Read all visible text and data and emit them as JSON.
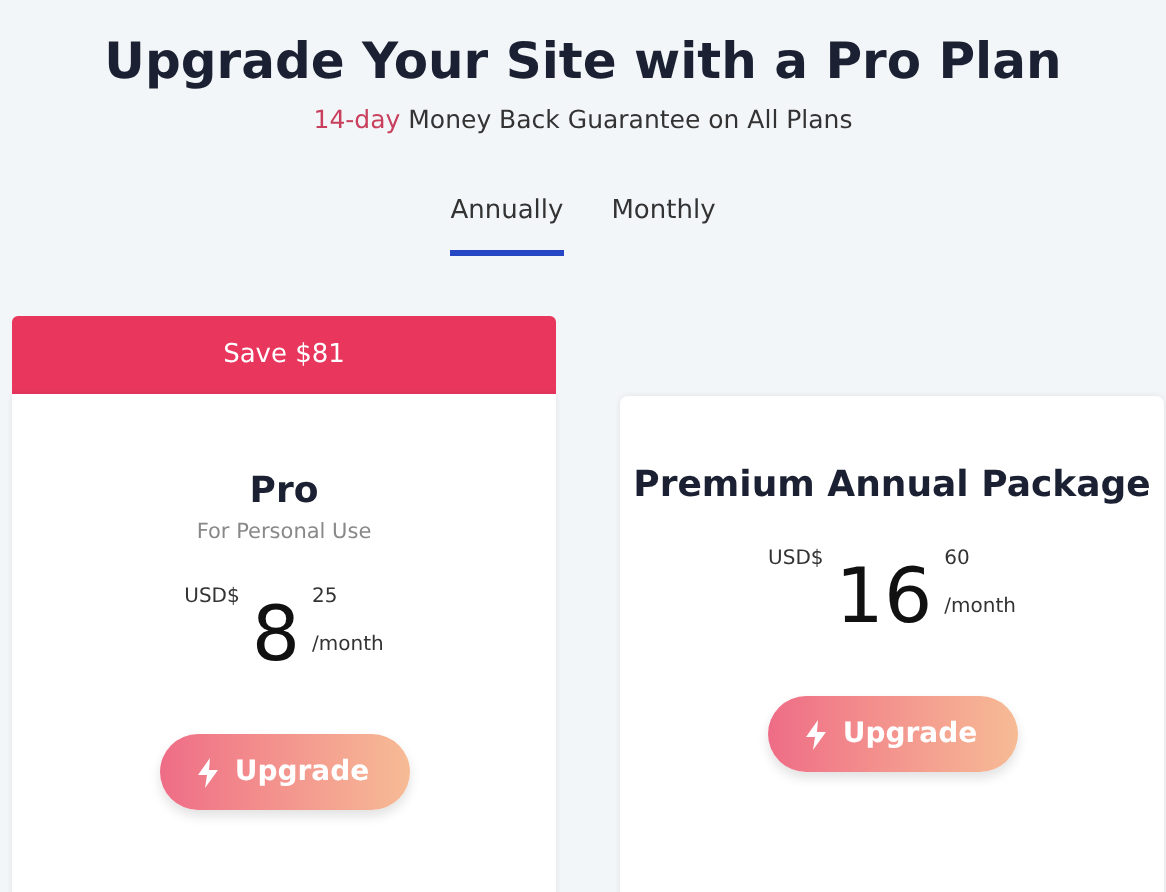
{
  "title": "Upgrade Your Site with a Pro Plan",
  "guarantee": {
    "highlight": "14-day",
    "text": "Money Back Guarantee on All Plans"
  },
  "tabs": [
    {
      "label": "Annually",
      "selected": true
    },
    {
      "label": "Monthly",
      "selected": false
    }
  ],
  "plans": [
    {
      "banner": "Save $81",
      "name": "Pro",
      "subtitle": "For Personal Use",
      "currency": "USD$",
      "amount": "8",
      "cents": "25",
      "period": "/month",
      "button": "Upgrade"
    },
    {
      "name": "Premium Annual Package",
      "currency": "USD$",
      "amount": "16",
      "cents": "60",
      "period": "/month",
      "button": "Upgrade"
    }
  ]
}
